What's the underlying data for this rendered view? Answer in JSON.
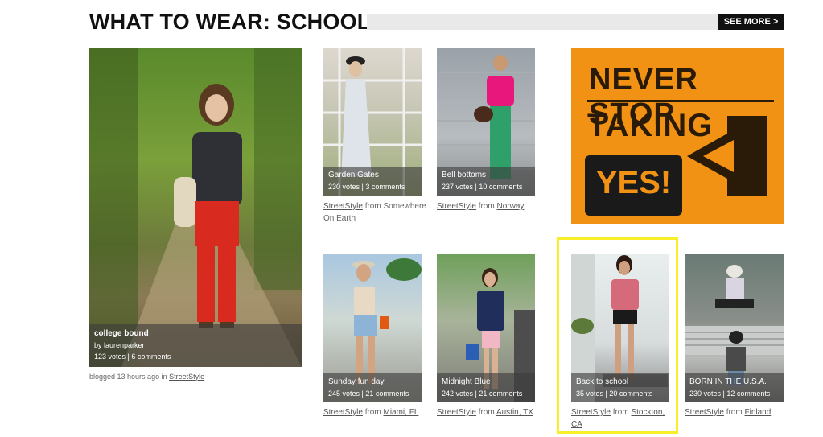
{
  "header": {
    "title": "WHAT TO WEAR: SCHOOL",
    "see_more": "SEE MORE >"
  },
  "featured": {
    "title": "college bound",
    "author": "by laurenparker",
    "stats": "123 votes | 6 comments",
    "blogged_prefix": "blogged 13 hours ago in",
    "blogged_link": "StreetStyle"
  },
  "tiles": [
    {
      "title": "Garden Gates",
      "stats": "230 votes | 3 comments",
      "source": "StreetStyle",
      "from": "from",
      "location": "Somewhere On Earth"
    },
    {
      "title": "Bell bottoms",
      "stats": "237 votes | 10 comments",
      "source": "StreetStyle",
      "from": "from",
      "location": "Norway"
    },
    {
      "title": "Sunday fun day",
      "stats": "245 votes | 21 comments",
      "source": "StreetStyle",
      "from": "from",
      "location": "Miami, FL"
    },
    {
      "title": "Midnight Blue",
      "stats": "242 votes | 21 comments",
      "source": "StreetStyle",
      "from": "from",
      "location": "Austin, TX"
    },
    {
      "title": "Back to school",
      "stats": "35 votes | 20 comments",
      "source": "StreetStyle",
      "from": "from",
      "location": "Stockton, CA"
    },
    {
      "title": "BORN IN THE U.S.A.",
      "stats": "230 votes | 12 comments",
      "source": "StreetStyle",
      "from": "from",
      "location": "Finland"
    }
  ],
  "ad": {
    "line1": "NEVER STOP",
    "line2": "TAKING",
    "button": "YES!"
  },
  "colors": {
    "highlight": "#f8ee2a",
    "ad_orange": "#f29214",
    "see_more_bg": "#111111"
  }
}
